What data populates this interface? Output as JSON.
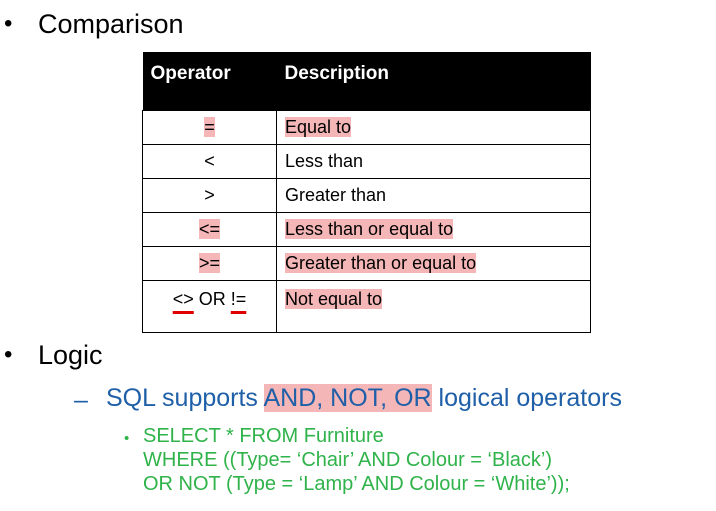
{
  "section1": {
    "bullet": "•",
    "title": "Comparison"
  },
  "table": {
    "headers": [
      "Operator",
      "Description"
    ],
    "rows": [
      {
        "operator": "=",
        "description": "Equal to"
      },
      {
        "operator": "<",
        "description": "Less than"
      },
      {
        "operator": ">",
        "description": "Greater than"
      },
      {
        "operator": "<=",
        "description": "Less than or equal to"
      },
      {
        "operator": ">=",
        "description": "Greater than or equal to"
      },
      {
        "operator_a": "<>",
        "operator_join": " OR ",
        "operator_b": "!=",
        "description": "Not equal to"
      }
    ]
  },
  "section2": {
    "bullet": "•",
    "title": "Logic",
    "dash": "–",
    "sub_prefix": "SQL supports ",
    "sub_highlight": "AND, NOT, OR",
    "sub_suffix": " logical operators",
    "code_bullet": "•",
    "code_lines": [
      "SELECT * FROM Furniture",
      "WHERE ((Type= ‘Chair’ AND Colour = ‘Black’)",
      "OR NOT (Type = ‘Lamp’ AND Colour = ‘White’));"
    ]
  },
  "colors": {
    "highlight": "#f4b6b6",
    "underline": "#e00000",
    "sub_text": "#1f5fa8",
    "code_text": "#2fb34a",
    "header_bg": "#000000"
  }
}
